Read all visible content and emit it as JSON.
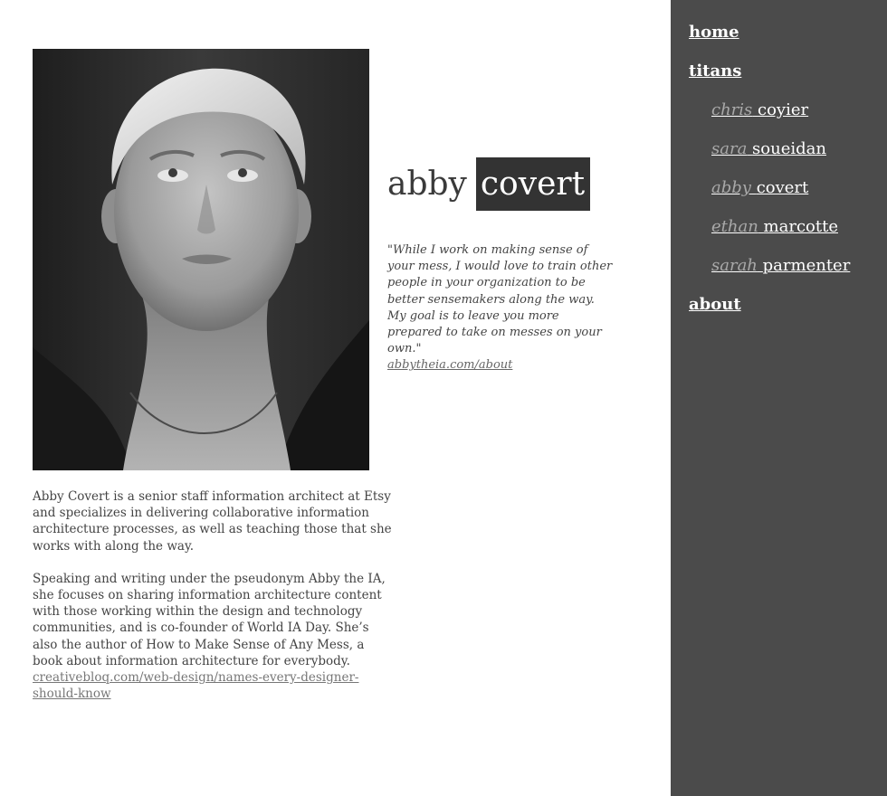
{
  "sidebar": {
    "nav": {
      "home": "home",
      "titans": "titans",
      "about": "about"
    },
    "titans": [
      {
        "first": "chris",
        "last": "coyier"
      },
      {
        "first": "sara",
        "last": "soueidan"
      },
      {
        "first": "abby",
        "last": "covert"
      },
      {
        "first": "ethan",
        "last": "marcotte"
      },
      {
        "first": "sarah",
        "last": "parmenter"
      }
    ]
  },
  "profile": {
    "first_name": "abby",
    "last_name": "covert",
    "quote": "\"While I work on making sense of your mess, I would love to train other people in your organization to be better sensemakers along the way. My goal is to leave you more prepared to take on messes on your own.\"",
    "quote_link": "abbytheia.com/about",
    "bio_paragraph_1": "Abby Covert is a senior staff information architect at Etsy and specializes in delivering collaborative information architecture processes, as well as teaching those that she works with along the way.",
    "bio_paragraph_2": "Speaking and writing under the pseudonym Abby the IA, she focuses on sharing information architecture content with those working within the design and technology communities, and is co-founder of World IA Day. She’s also the author of How to Make Sense of Any Mess, a book about information architecture for everybody.",
    "bio_link": "creativebloq.com/web-design/names-every-designer-should-know"
  }
}
